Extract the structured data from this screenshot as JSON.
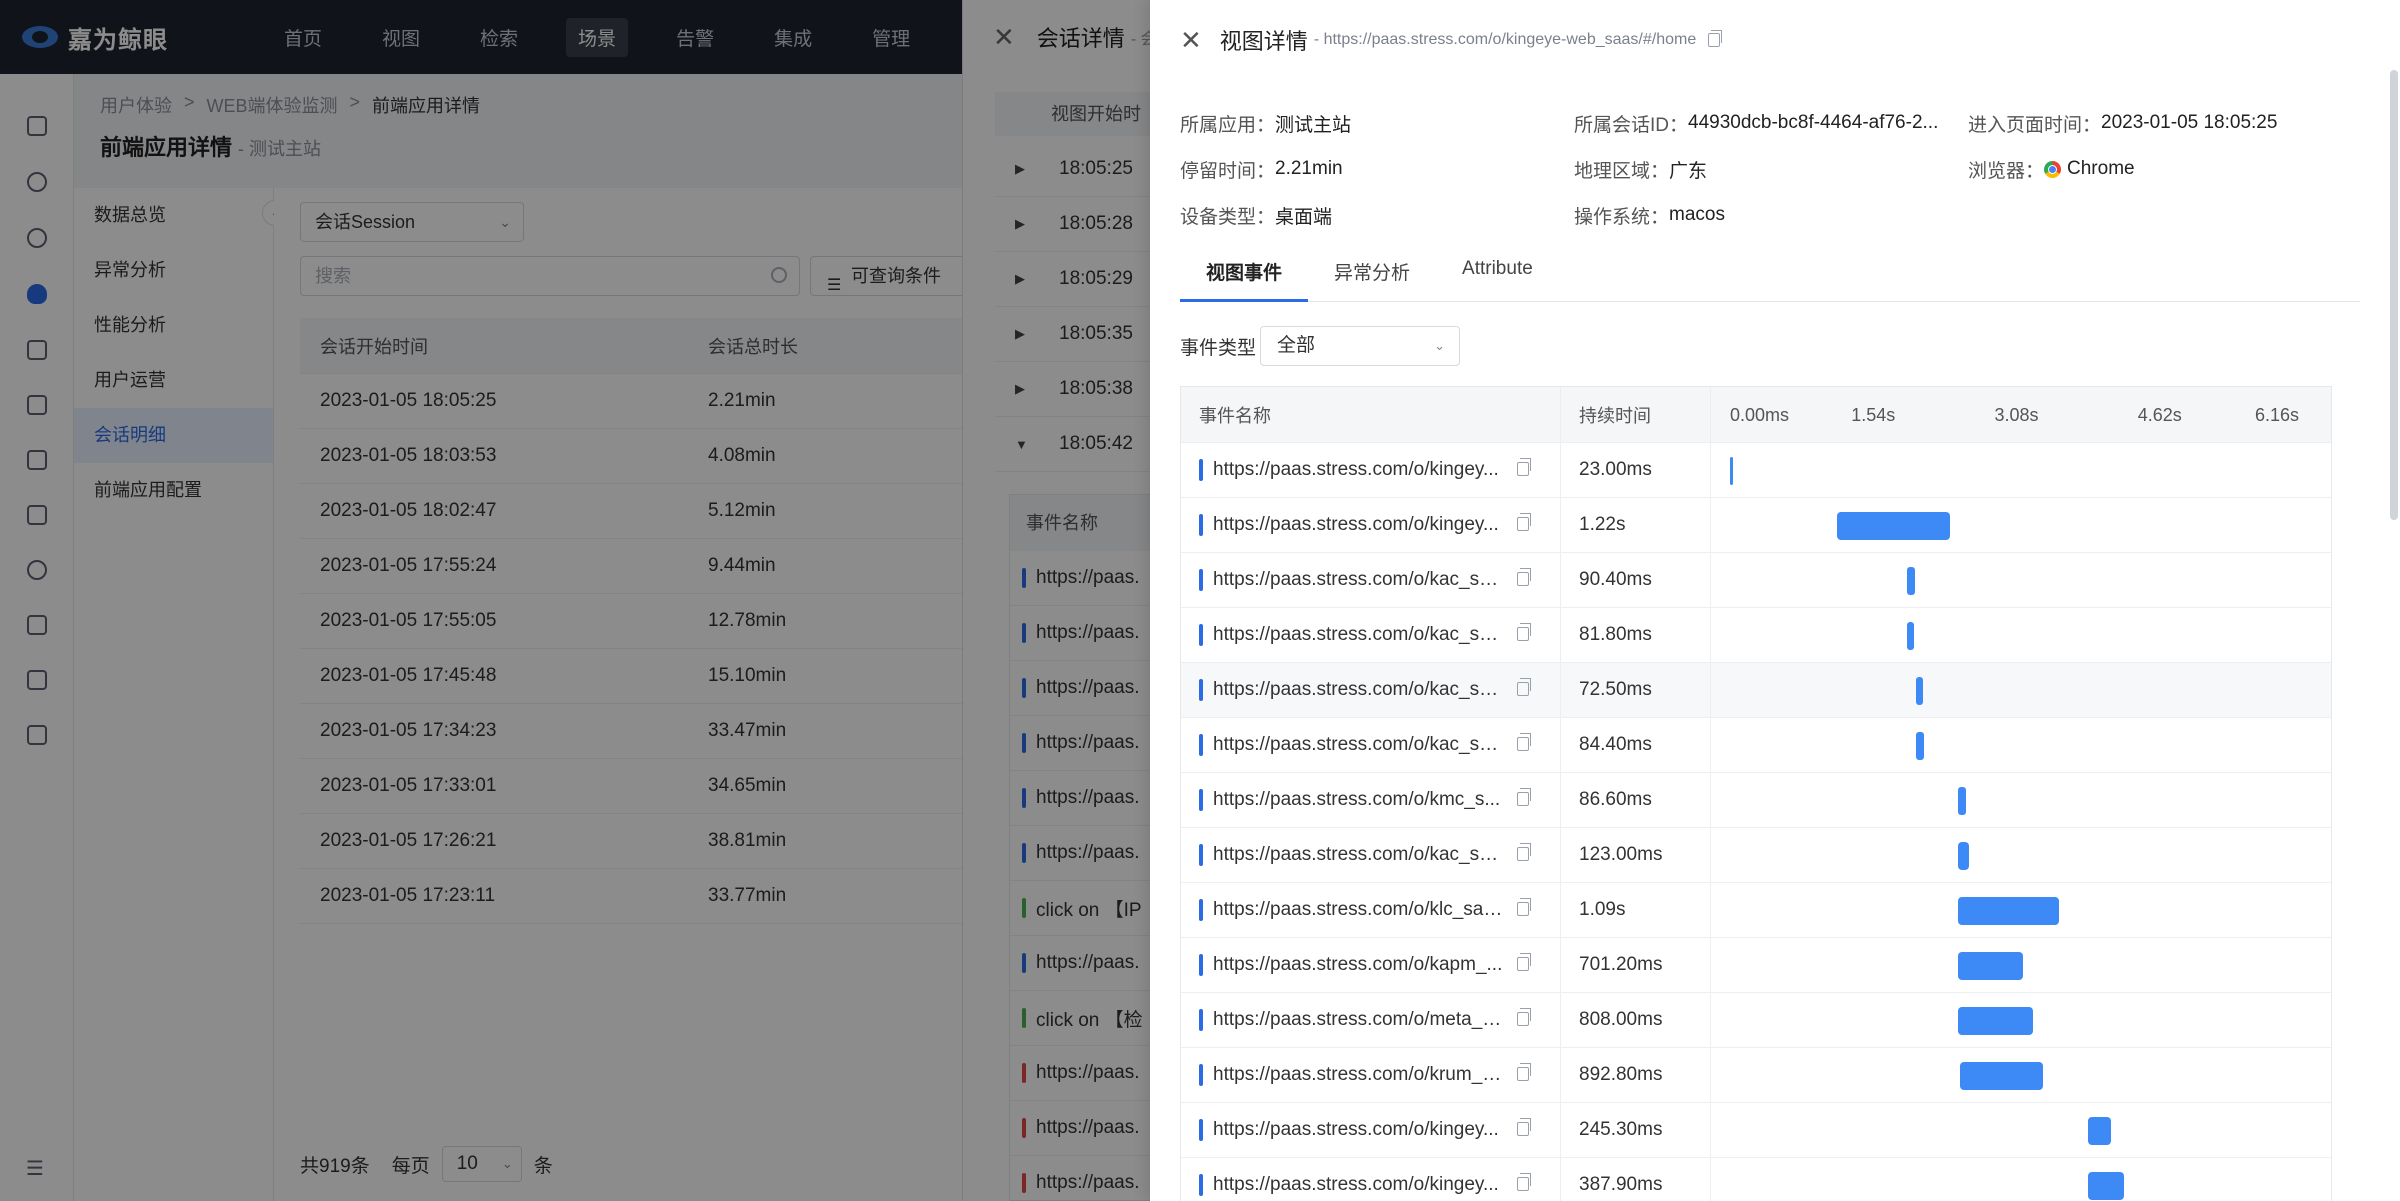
{
  "topbar": {
    "brand": "嘉为鲸眼",
    "nav": [
      "首页",
      "视图",
      "检索",
      "场景",
      "告警",
      "集成",
      "管理"
    ],
    "active_index": 3
  },
  "breadcrumb": [
    "用户体验",
    ">",
    "WEB端体验监测",
    ">",
    "前端应用详情"
  ],
  "page": {
    "title": "前端应用详情",
    "subtitle": "- 测试主站"
  },
  "subnav": [
    "数据总览",
    "异常分析",
    "性能分析",
    "用户运营",
    "会话明细",
    "前端应用配置"
  ],
  "subnav_active": 4,
  "main": {
    "select_value": "会话Session",
    "search_placeholder": "搜索",
    "query_button": "可查询条件",
    "columns": [
      "会话开始时间",
      "会话总时长"
    ],
    "rows": [
      [
        "2023-01-05 18:05:25",
        "2.21min"
      ],
      [
        "2023-01-05 18:03:53",
        "4.08min"
      ],
      [
        "2023-01-05 18:02:47",
        "5.12min"
      ],
      [
        "2023-01-05 17:55:24",
        "9.44min"
      ],
      [
        "2023-01-05 17:55:05",
        "12.78min"
      ],
      [
        "2023-01-05 17:45:48",
        "15.10min"
      ],
      [
        "2023-01-05 17:34:23",
        "33.47min"
      ],
      [
        "2023-01-05 17:33:01",
        "34.65min"
      ],
      [
        "2023-01-05 17:26:21",
        "38.81min"
      ],
      [
        "2023-01-05 17:23:11",
        "33.77min"
      ]
    ],
    "pager": {
      "total": "共919条",
      "per_page_label": "每页",
      "per_page": "10",
      "unit": "条"
    }
  },
  "session_panel": {
    "title": "会话详情",
    "title_suffix": "- 会",
    "column": "视图开始时",
    "rows": [
      "18:05:25",
      "18:05:28",
      "18:05:29",
      "18:05:35",
      "18:05:38",
      "18:05:42"
    ],
    "sub_column": "事件名称",
    "sub_rows": [
      {
        "text": "https://paas.",
        "color": "#2b6be6"
      },
      {
        "text": "https://paas.",
        "color": "#2b6be6"
      },
      {
        "text": "https://paas.",
        "color": "#2b6be6"
      },
      {
        "text": "https://paas.",
        "color": "#2b6be6"
      },
      {
        "text": "https://paas.",
        "color": "#2b6be6"
      },
      {
        "text": "https://paas.",
        "color": "#2b6be6"
      },
      {
        "text": "click on 【IP",
        "color": "#4caf50"
      },
      {
        "text": "https://paas.",
        "color": "#2b6be6"
      },
      {
        "text": "click on 【检",
        "color": "#4caf50"
      },
      {
        "text": "https://paas.",
        "color": "#e04848"
      },
      {
        "text": "https://paas.",
        "color": "#e04848"
      },
      {
        "text": "https://paas.",
        "color": "#e04848"
      }
    ]
  },
  "drawer": {
    "title": "视图详情",
    "url": "- https://paas.stress.com/o/kingeye-web_saas/#/home",
    "info": [
      [
        {
          "label": "所属应用：",
          "value": "测试主站"
        },
        {
          "label": "所属会话ID：",
          "value": "44930dcb-bc8f-4464-af76-2..."
        },
        {
          "label": "进入页面时间：",
          "value": "2023-01-05 18:05:25"
        }
      ],
      [
        {
          "label": "停留时间：",
          "value": "2.21min"
        },
        {
          "label": "地理区域：",
          "value": "广东"
        },
        {
          "label": "浏览器：",
          "value": "Chrome"
        }
      ],
      [
        {
          "label": "设备类型：",
          "value": "桌面端"
        },
        {
          "label": "操作系统：",
          "value": "macos"
        }
      ]
    ],
    "tabs": [
      "视图事件",
      "异常分析",
      "Attribute"
    ],
    "active_tab": 0,
    "filter_label": "事件类型",
    "filter_value": "全部",
    "columns": [
      "事件名称",
      "持续时间"
    ],
    "ticks": [
      "0.00ms",
      "1.54s",
      "3.08s",
      "4.62s",
      "6.16s"
    ],
    "events": [
      {
        "name": "https://paas.stress.com/o/kingey...",
        "duration": "23.00ms",
        "start_s": 0.0,
        "dur_s": 0.023
      },
      {
        "name": "https://paas.stress.com/o/kingey...",
        "duration": "1.22s",
        "start_s": 1.15,
        "dur_s": 1.22
      },
      {
        "name": "https://paas.stress.com/o/kac_sa...",
        "duration": "90.40ms",
        "start_s": 1.9,
        "dur_s": 0.0904
      },
      {
        "name": "https://paas.stress.com/o/kac_sa...",
        "duration": "81.80ms",
        "start_s": 1.9,
        "dur_s": 0.0818
      },
      {
        "name": "https://paas.stress.com/o/kac_sa...",
        "duration": "72.50ms",
        "start_s": 2.0,
        "dur_s": 0.0725
      },
      {
        "name": "https://paas.stress.com/o/kac_sa...",
        "duration": "84.40ms",
        "start_s": 2.0,
        "dur_s": 0.0844
      },
      {
        "name": "https://paas.stress.com/o/kmc_s...",
        "duration": "86.60ms",
        "start_s": 2.45,
        "dur_s": 0.0866
      },
      {
        "name": "https://paas.stress.com/o/kac_sa...",
        "duration": "123.00ms",
        "start_s": 2.45,
        "dur_s": 0.123
      },
      {
        "name": "https://paas.stress.com/o/klc_saa...",
        "duration": "1.09s",
        "start_s": 2.45,
        "dur_s": 1.09
      },
      {
        "name": "https://paas.stress.com/o/kapm_...",
        "duration": "701.20ms",
        "start_s": 2.45,
        "dur_s": 0.7012
      },
      {
        "name": "https://paas.stress.com/o/meta_s...",
        "duration": "808.00ms",
        "start_s": 2.45,
        "dur_s": 0.808
      },
      {
        "name": "https://paas.stress.com/o/krum_s...",
        "duration": "892.80ms",
        "start_s": 2.47,
        "dur_s": 0.8928
      },
      {
        "name": "https://paas.stress.com/o/kingey...",
        "duration": "245.30ms",
        "start_s": 3.85,
        "dur_s": 0.2453
      },
      {
        "name": "https://paas.stress.com/o/kingey...",
        "duration": "387.90ms",
        "start_s": 3.85,
        "dur_s": 0.3879
      }
    ],
    "axis_max_s": 6.16,
    "bar_color": "#3d8af7"
  }
}
